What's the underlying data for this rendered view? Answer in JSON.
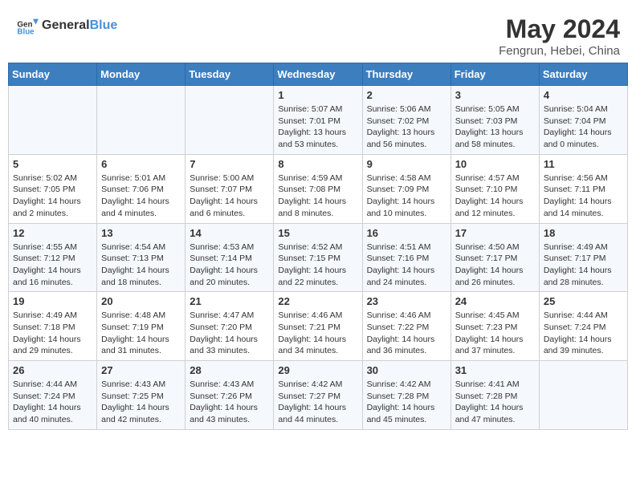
{
  "header": {
    "logo_general": "General",
    "logo_blue": "Blue",
    "title": "May 2024",
    "location": "Fengrun, Hebei, China"
  },
  "days_of_week": [
    "Sunday",
    "Monday",
    "Tuesday",
    "Wednesday",
    "Thursday",
    "Friday",
    "Saturday"
  ],
  "weeks": [
    [
      {
        "day": "",
        "content": ""
      },
      {
        "day": "",
        "content": ""
      },
      {
        "day": "",
        "content": ""
      },
      {
        "day": "1",
        "content": "Sunrise: 5:07 AM\nSunset: 7:01 PM\nDaylight: 13 hours and 53 minutes."
      },
      {
        "day": "2",
        "content": "Sunrise: 5:06 AM\nSunset: 7:02 PM\nDaylight: 13 hours and 56 minutes."
      },
      {
        "day": "3",
        "content": "Sunrise: 5:05 AM\nSunset: 7:03 PM\nDaylight: 13 hours and 58 minutes."
      },
      {
        "day": "4",
        "content": "Sunrise: 5:04 AM\nSunset: 7:04 PM\nDaylight: 14 hours and 0 minutes."
      }
    ],
    [
      {
        "day": "5",
        "content": "Sunrise: 5:02 AM\nSunset: 7:05 PM\nDaylight: 14 hours and 2 minutes."
      },
      {
        "day": "6",
        "content": "Sunrise: 5:01 AM\nSunset: 7:06 PM\nDaylight: 14 hours and 4 minutes."
      },
      {
        "day": "7",
        "content": "Sunrise: 5:00 AM\nSunset: 7:07 PM\nDaylight: 14 hours and 6 minutes."
      },
      {
        "day": "8",
        "content": "Sunrise: 4:59 AM\nSunset: 7:08 PM\nDaylight: 14 hours and 8 minutes."
      },
      {
        "day": "9",
        "content": "Sunrise: 4:58 AM\nSunset: 7:09 PM\nDaylight: 14 hours and 10 minutes."
      },
      {
        "day": "10",
        "content": "Sunrise: 4:57 AM\nSunset: 7:10 PM\nDaylight: 14 hours and 12 minutes."
      },
      {
        "day": "11",
        "content": "Sunrise: 4:56 AM\nSunset: 7:11 PM\nDaylight: 14 hours and 14 minutes."
      }
    ],
    [
      {
        "day": "12",
        "content": "Sunrise: 4:55 AM\nSunset: 7:12 PM\nDaylight: 14 hours and 16 minutes."
      },
      {
        "day": "13",
        "content": "Sunrise: 4:54 AM\nSunset: 7:13 PM\nDaylight: 14 hours and 18 minutes."
      },
      {
        "day": "14",
        "content": "Sunrise: 4:53 AM\nSunset: 7:14 PM\nDaylight: 14 hours and 20 minutes."
      },
      {
        "day": "15",
        "content": "Sunrise: 4:52 AM\nSunset: 7:15 PM\nDaylight: 14 hours and 22 minutes."
      },
      {
        "day": "16",
        "content": "Sunrise: 4:51 AM\nSunset: 7:16 PM\nDaylight: 14 hours and 24 minutes."
      },
      {
        "day": "17",
        "content": "Sunrise: 4:50 AM\nSunset: 7:17 PM\nDaylight: 14 hours and 26 minutes."
      },
      {
        "day": "18",
        "content": "Sunrise: 4:49 AM\nSunset: 7:17 PM\nDaylight: 14 hours and 28 minutes."
      }
    ],
    [
      {
        "day": "19",
        "content": "Sunrise: 4:49 AM\nSunset: 7:18 PM\nDaylight: 14 hours and 29 minutes."
      },
      {
        "day": "20",
        "content": "Sunrise: 4:48 AM\nSunset: 7:19 PM\nDaylight: 14 hours and 31 minutes."
      },
      {
        "day": "21",
        "content": "Sunrise: 4:47 AM\nSunset: 7:20 PM\nDaylight: 14 hours and 33 minutes."
      },
      {
        "day": "22",
        "content": "Sunrise: 4:46 AM\nSunset: 7:21 PM\nDaylight: 14 hours and 34 minutes."
      },
      {
        "day": "23",
        "content": "Sunrise: 4:46 AM\nSunset: 7:22 PM\nDaylight: 14 hours and 36 minutes."
      },
      {
        "day": "24",
        "content": "Sunrise: 4:45 AM\nSunset: 7:23 PM\nDaylight: 14 hours and 37 minutes."
      },
      {
        "day": "25",
        "content": "Sunrise: 4:44 AM\nSunset: 7:24 PM\nDaylight: 14 hours and 39 minutes."
      }
    ],
    [
      {
        "day": "26",
        "content": "Sunrise: 4:44 AM\nSunset: 7:24 PM\nDaylight: 14 hours and 40 minutes."
      },
      {
        "day": "27",
        "content": "Sunrise: 4:43 AM\nSunset: 7:25 PM\nDaylight: 14 hours and 42 minutes."
      },
      {
        "day": "28",
        "content": "Sunrise: 4:43 AM\nSunset: 7:26 PM\nDaylight: 14 hours and 43 minutes."
      },
      {
        "day": "29",
        "content": "Sunrise: 4:42 AM\nSunset: 7:27 PM\nDaylight: 14 hours and 44 minutes."
      },
      {
        "day": "30",
        "content": "Sunrise: 4:42 AM\nSunset: 7:28 PM\nDaylight: 14 hours and 45 minutes."
      },
      {
        "day": "31",
        "content": "Sunrise: 4:41 AM\nSunset: 7:28 PM\nDaylight: 14 hours and 47 minutes."
      },
      {
        "day": "",
        "content": ""
      }
    ]
  ]
}
